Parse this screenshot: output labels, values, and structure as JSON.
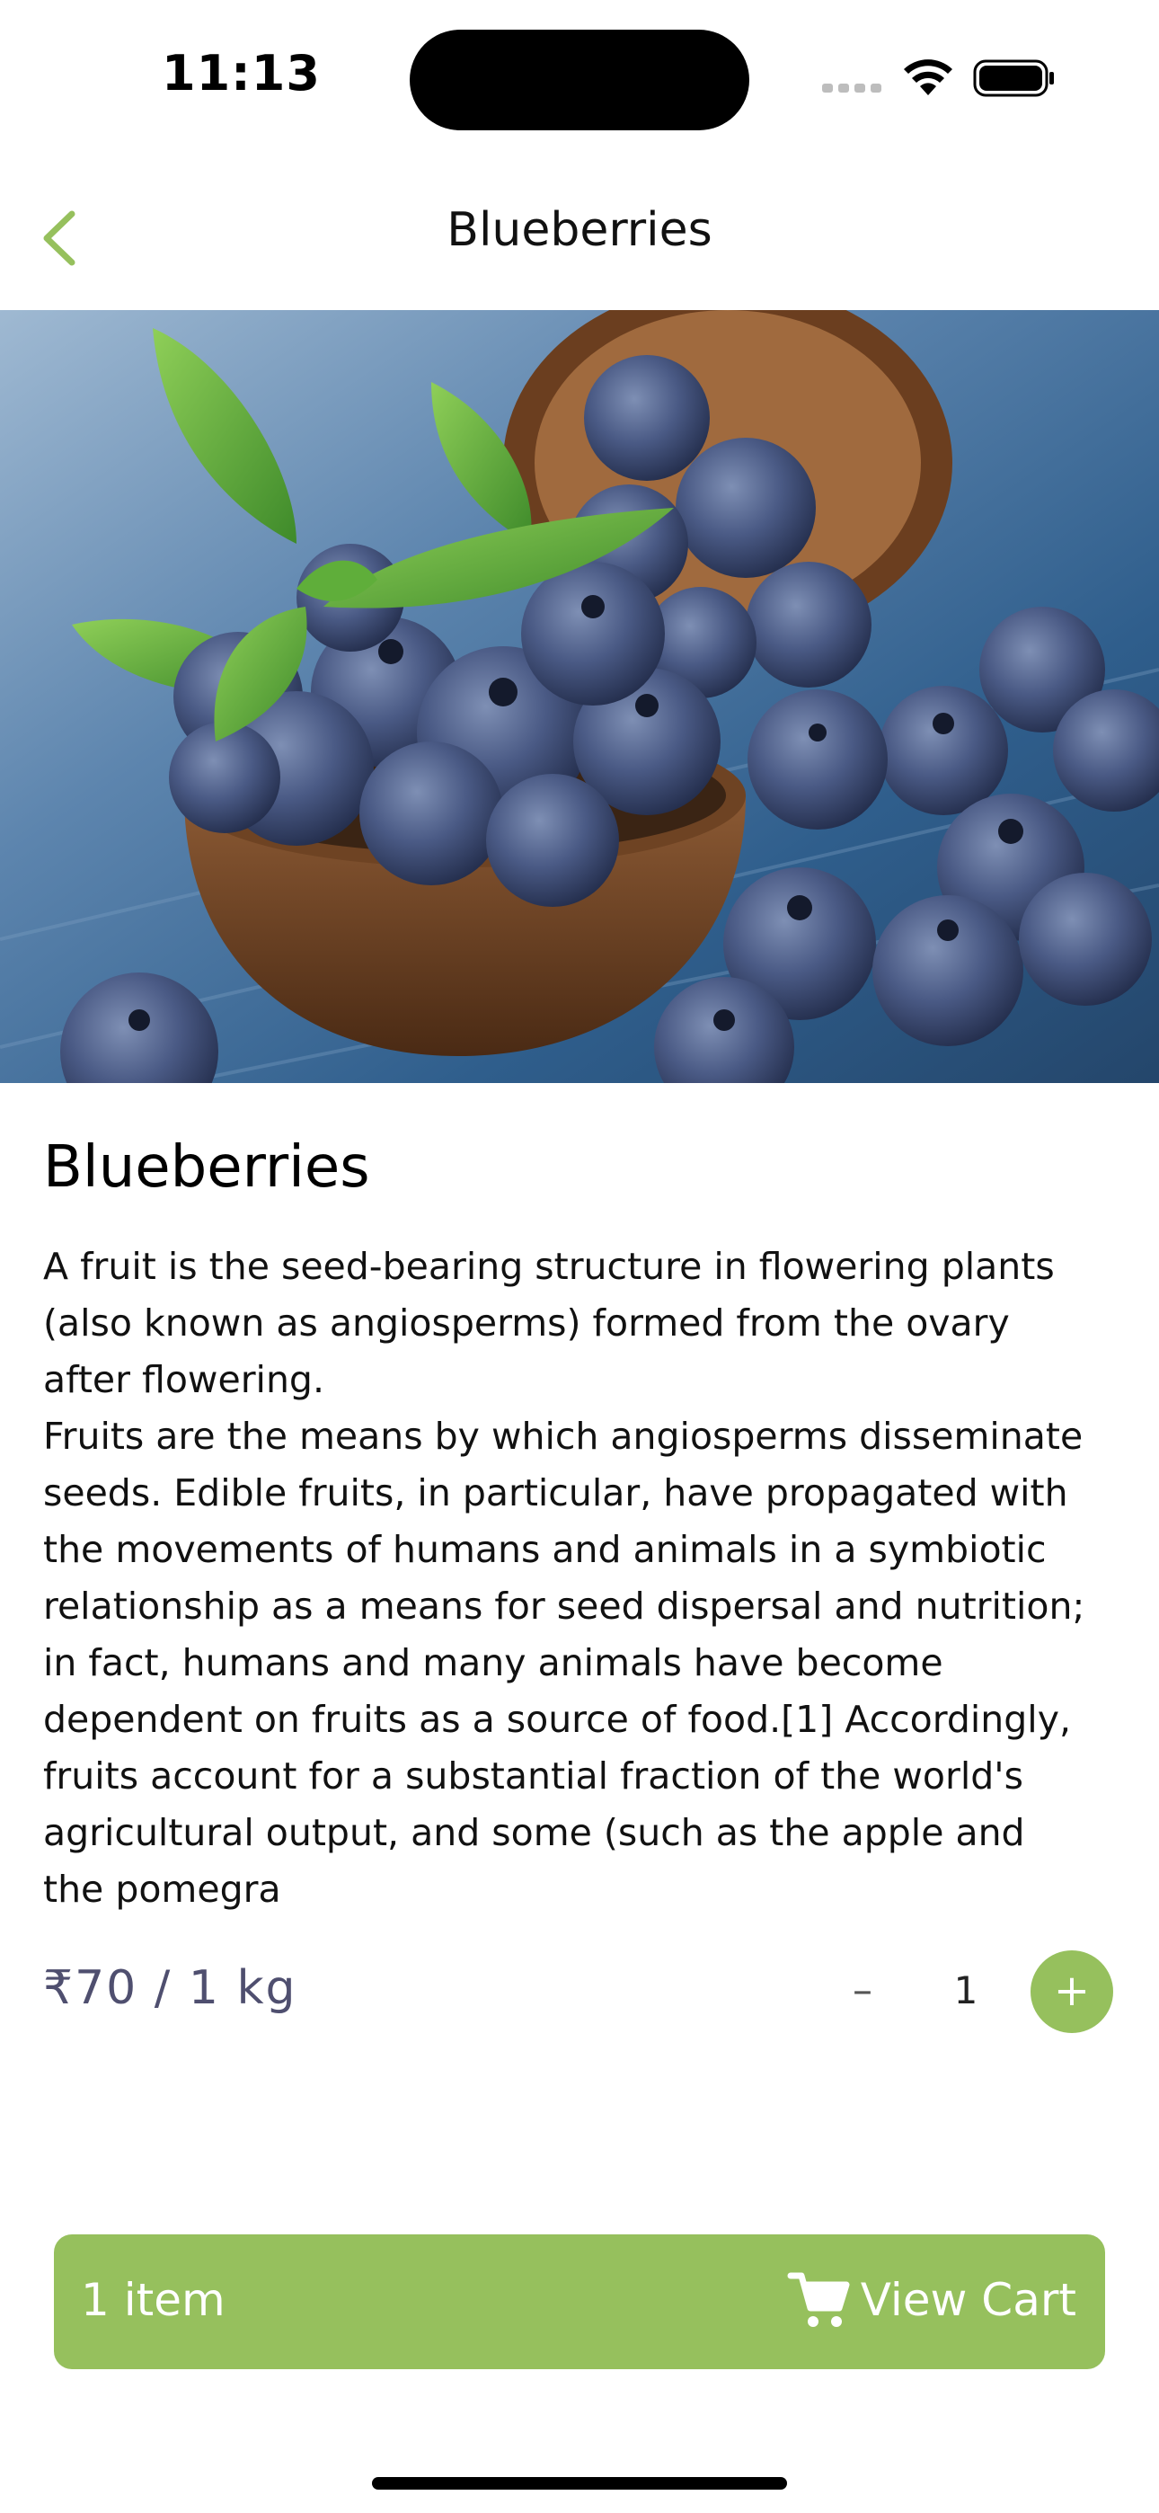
{
  "status_bar": {
    "time": "11:13"
  },
  "header": {
    "title": "Blueberries"
  },
  "product": {
    "name": "Blueberries",
    "description": "A fruit is the seed-bearing structure in flowering plants\n(also known as angiosperms) formed from the ovary\nafter flowering.\nFruits are the means by which angiosperms disseminate\nseeds. Edible fruits, in particular, have propagated with\nthe movements of humans and animals in a symbiotic\nrelationship as a means for seed dispersal and nutrition;\nin fact, humans and many animals have become\ndependent on fruits as a source of food.[1] Accordingly,\nfruits account for a substantial fraction of the world's\nagricultural output, and some (such as the apple and\nthe pomegra",
    "price": "₹70 / 1 kg"
  },
  "quantity": {
    "minus_label": "–",
    "value": "1",
    "plus_label": "+"
  },
  "cart": {
    "count_label": "1 item",
    "button_label": "View Cart"
  },
  "colors": {
    "accent": "#96c05d",
    "price": "#4f4f6f"
  }
}
